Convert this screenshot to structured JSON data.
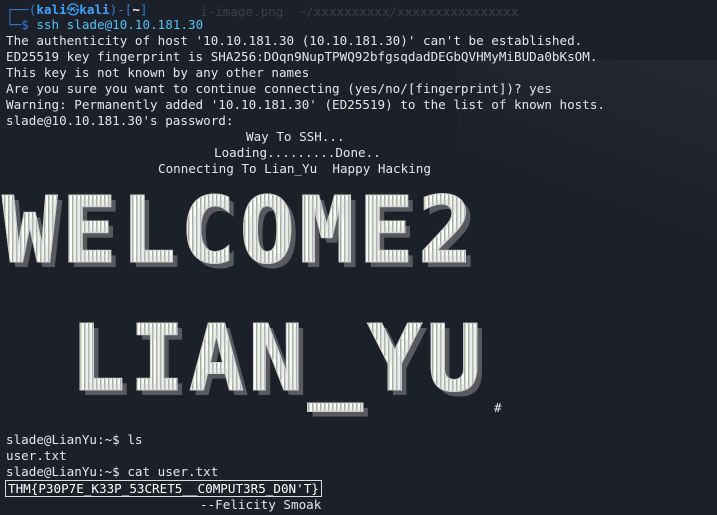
{
  "prompt": {
    "top_left": "┌──(",
    "user": "kali",
    "skull": "㉿",
    "host": "kali",
    "close": ")-[",
    "dir": "~",
    "end": "]",
    "arrow": "└─$",
    "command": "ssh slade@10.10.181.30"
  },
  "ghost_text": "i-image.png  ~/xxxxxxxxxx/xxxxxxxxxxxxxxxx",
  "output_lines": [
    "The authenticity of host '10.10.181.30 (10.10.181.30)' can't be established.",
    "ED25519 key fingerprint is SHA256:DOqn9NupTPWQ92bfgsqdadDEGbQVHMyMiBUDa0bKsOM.",
    "This key is not known by any other names",
    "Are you sure you want to continue connecting (yes/no/[fingerprint])? yes",
    "Warning: Permanently added '10.10.181.30' (ED25519) to the list of known hosts.",
    "slade@10.10.181.30's password:"
  ],
  "motd": {
    "line1": "Way To SSH...",
    "line2": "Loading.........Done..",
    "line3": "Connecting To Lian_Yu  Happy Hacking"
  },
  "banner": {
    "line1": "WELCOME2",
    "line2": "LIAN_YU",
    "hash": "#"
  },
  "session": [
    "slade@LianYu:~$ ls",
    "user.txt",
    "slade@LianYu:~$ cat user.txt"
  ],
  "flag": "THM{P30P7E_K33P_53CRET5__C0MPUT3R5_D0N'T}",
  "signature": "--Felicity Smoak",
  "colors": {
    "background": "#1c2029",
    "prompt_blue": "#3ea3ff",
    "text": "#e6e6e6"
  }
}
